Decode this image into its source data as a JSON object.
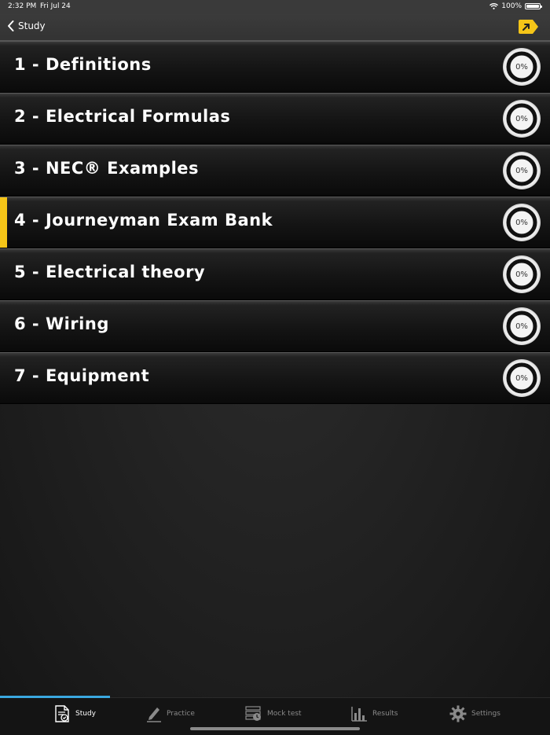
{
  "status_bar": {
    "time": "2:32 PM",
    "date": "Fri Jul 24",
    "battery": "100%"
  },
  "nav": {
    "back_label": "Study"
  },
  "colors": {
    "accent": "#f5c518",
    "tab_active": "#3aa8e0"
  },
  "chapters": [
    {
      "title": "1 - Definitions",
      "progress": "0%"
    },
    {
      "title": "2 - Electrical Formulas",
      "progress": "0%"
    },
    {
      "title": "3 - NEC® Examples",
      "progress": "0%"
    },
    {
      "title": "4 - Journeyman Exam Bank",
      "progress": "0%",
      "selected": true
    },
    {
      "title": "5 - Electrical theory",
      "progress": "0%"
    },
    {
      "title": "6 - Wiring",
      "progress": "0%"
    },
    {
      "title": "7 - Equipment",
      "progress": "0%"
    }
  ],
  "tabs": [
    {
      "label": "Study",
      "icon": "study-icon",
      "active": true
    },
    {
      "label": "Practice",
      "icon": "pencil-icon"
    },
    {
      "label": "Mock test",
      "icon": "mock-test-icon"
    },
    {
      "label": "Results",
      "icon": "bar-chart-icon"
    },
    {
      "label": "Settings",
      "icon": "gear-icon"
    }
  ]
}
